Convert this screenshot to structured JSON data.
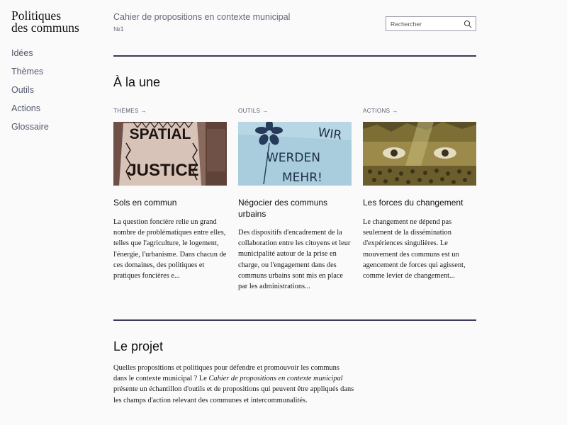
{
  "site": {
    "title_line1": "Politiques",
    "title_line2": "des communs"
  },
  "nav": [
    "Idées",
    "Thèmes",
    "Outils",
    "Actions",
    "Glossaire"
  ],
  "header": {
    "subtitle": "Cahier de propositions en contexte municipal",
    "number": "№1"
  },
  "search": {
    "placeholder": "Rechercher"
  },
  "featured": {
    "title": "À la une",
    "cards": [
      {
        "category": "THÈMES",
        "arrow": "→",
        "image_text": [
          "SPATIAL",
          "JUSTICE"
        ],
        "title": "Sols en commun",
        "excerpt": "La question foncière relie un grand nombre de problématiques entre elles, telles que l'agriculture, le logement, l'énergie, l'urbanisme. Dans chacun de ces domaines, des politiques et pratiques foncières e..."
      },
      {
        "category": "OUTILS",
        "arrow": "→",
        "image_text": [
          "WIR",
          "WERDEN",
          "MEHR!"
        ],
        "title": "Négocier des communs urbains",
        "excerpt": "Des dispositifs d'encadrement de la collaboration entre les citoyens et leur municipalité autour de la prise en charge, ou l'engagement dans des communs urbains sont mis en place par les administrations..."
      },
      {
        "category": "ACTIONS",
        "arrow": "→",
        "title": "Les forces du changement",
        "excerpt": "Le changement ne dépend pas seulement de la dissémination d'expériences singulières. Le mouvement des communs est un agencement de forces qui agissent, comme levier de changement..."
      }
    ]
  },
  "project": {
    "title": "Le projet",
    "text_part1": "Quelles propositions et politiques pour défendre et promouvoir les communs dans le contexte municipal ? Le ",
    "text_italic": "Cahier de propositions en contexte municipal",
    "text_part2": " présente un échantillon d'outils et de propositions qui peuvent être appliqués dans les champs d'action relevant des communes et intercommunalités."
  },
  "colors": {
    "thumb_themes": "#8b6a5e",
    "thumb_outils": "#a9cddd",
    "thumb_actions": "#9c8a4a",
    "rule": "#3a3a5c"
  }
}
